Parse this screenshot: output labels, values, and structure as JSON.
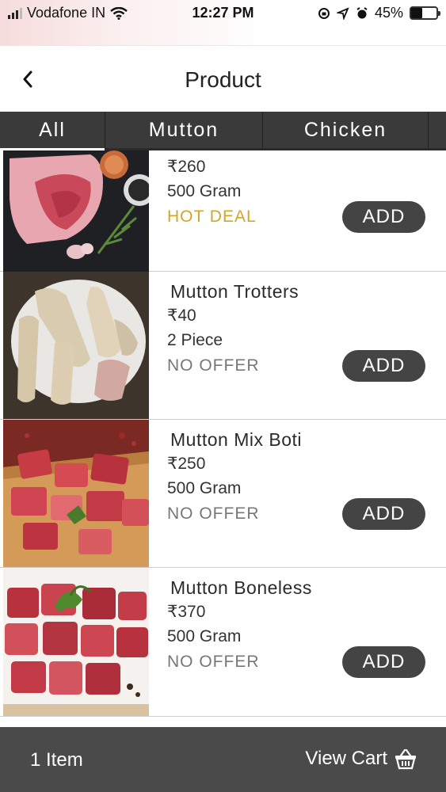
{
  "status_bar": {
    "carrier": "Vodafone IN",
    "time": "12:27 PM",
    "battery": "45%",
    "battery_level": 0.45,
    "icons": [
      "signal-icon",
      "wifi-icon",
      "rotation-lock-icon",
      "location-icon",
      "alarm-icon",
      "battery-icon"
    ]
  },
  "header": {
    "title": "Product",
    "back_icon": "chevron-left-icon"
  },
  "tabs": [
    {
      "label": "All",
      "active": true
    },
    {
      "label": "Mutton",
      "active": false
    },
    {
      "label": "Chicken",
      "active": false
    }
  ],
  "products": [
    {
      "name": "",
      "price": "₹260",
      "quantity": "500 Gram",
      "offer": "HOT DEAL",
      "add_label": "ADD"
    },
    {
      "name": "Mutton Trotters",
      "price": "₹40",
      "quantity": "2 Piece",
      "offer": "NO OFFER",
      "add_label": "ADD"
    },
    {
      "name": "Mutton Mix Boti",
      "price": "₹250",
      "quantity": "500 Gram",
      "offer": "NO OFFER",
      "add_label": "ADD"
    },
    {
      "name": "Mutton Boneless",
      "price": "₹370",
      "quantity": "500 Gram",
      "offer": "NO OFFER",
      "add_label": "ADD"
    }
  ],
  "cart_bar": {
    "item_count": "1 Item",
    "view_cart_label": "View Cart",
    "cart_icon": "basket-icon"
  },
  "colors": {
    "tab_bar": "#3a3a3a",
    "button": "#444444",
    "hot_deal": "#d4a52c",
    "no_offer": "#777777",
    "bottom_bar": "#4a4a4a"
  }
}
